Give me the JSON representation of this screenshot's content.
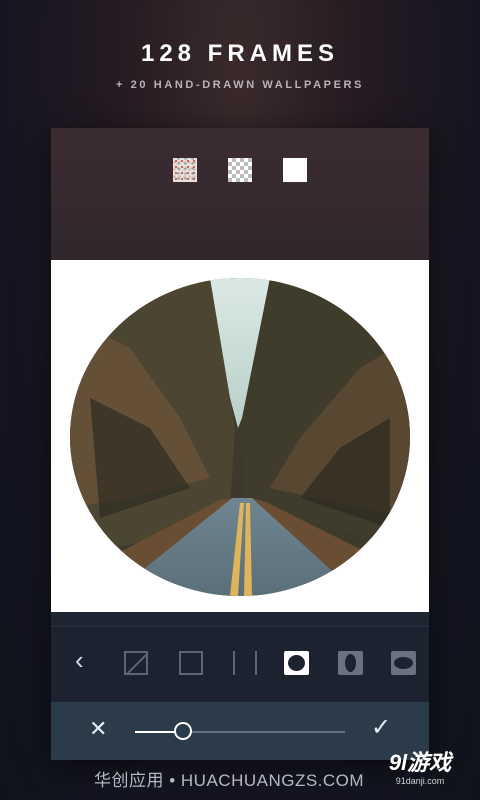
{
  "promo": {
    "headline": "128 FRAMES",
    "subline": "+ 20 HAND-DRAWN WALLPAPERS"
  },
  "background_swatches": [
    {
      "name": "pattern"
    },
    {
      "name": "transparent"
    },
    {
      "name": "white"
    }
  ],
  "frame_toolbar": {
    "items": [
      "back",
      "no-frame",
      "square",
      "bars",
      "circle",
      "oval-vertical",
      "oval-horizontal"
    ],
    "selected": "circle"
  },
  "slider": {
    "value_fraction": 0.23
  },
  "colors": {
    "canvas": "#ffffff",
    "toolbar": "#1d2230",
    "slider_bar": "#2b3b49"
  },
  "watermark": {
    "left": "华创应用 • HUACHUANGZS.COM",
    "logo": "9l游戏",
    "logo_url": "91danji.com"
  }
}
